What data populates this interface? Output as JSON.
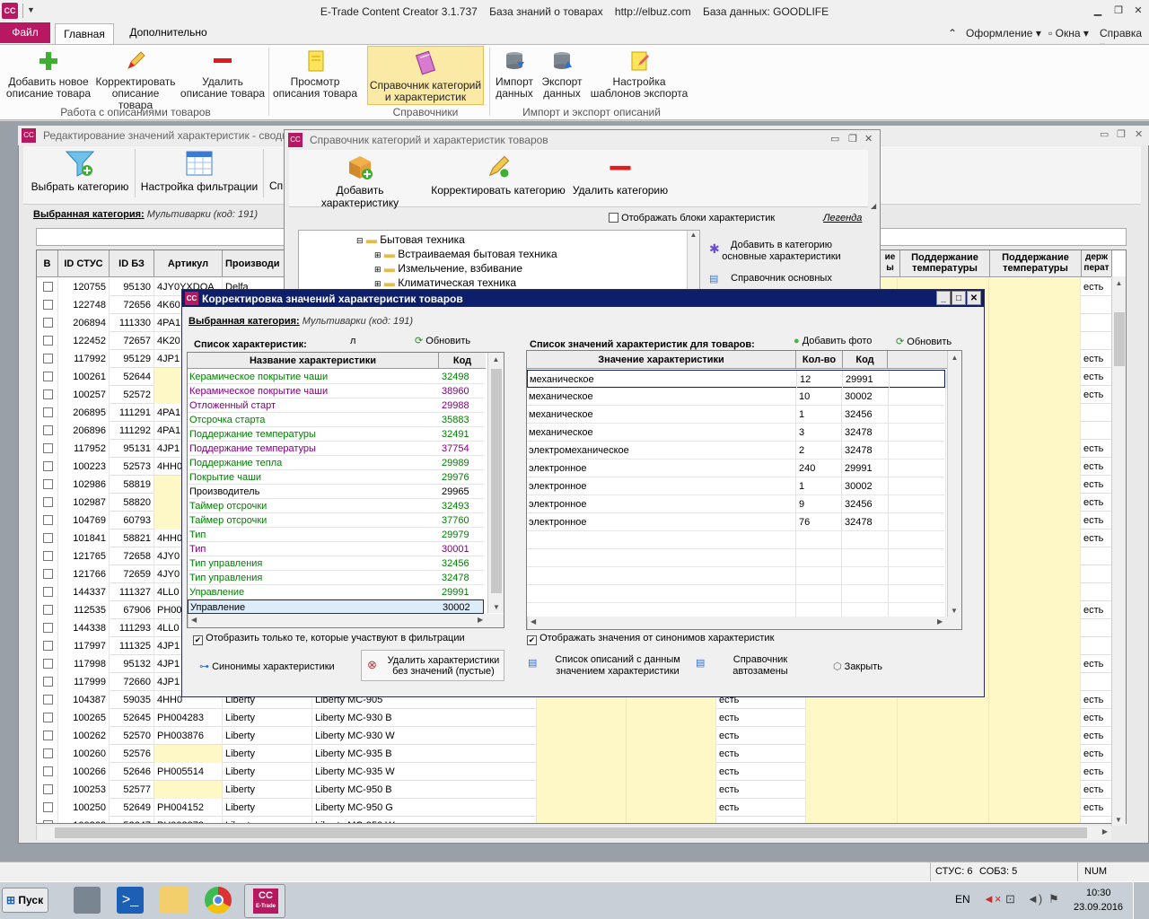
{
  "window": {
    "app": "E-Trade Content Creator 3.1.737",
    "kb": "База знаний о товарах",
    "url": "http://elbuz.com",
    "db": "База данных: GOODLIFE"
  },
  "ribbon_tabs": {
    "file": "Файл",
    "main": "Главная",
    "extra": "Дополнительно"
  },
  "ribbon_right": {
    "design": "Оформление",
    "windows": "Окна",
    "help": "Справка"
  },
  "ribbon": {
    "add_l1": "Добавить новое",
    "add_l2": "описание товара",
    "edit_l1": "Корректировать",
    "edit_l2": "описание товара",
    "del_l1": "Удалить",
    "del_l2": "описание товара",
    "view_l1": "Просмотр",
    "view_l2": "описания товара",
    "cat_l1": "Справочник категорий",
    "cat_l2": "и характеристик",
    "imp_l1": "Импорт",
    "imp_l2": "данных",
    "exp_l1": "Экспорт",
    "exp_l2": "данных",
    "tpl_l1": "Настройка",
    "tpl_l2": "шаблонов экспорта",
    "group1": "Работа с описаниями товаров",
    "group2": "Справочники",
    "group3": "Импорт и экспорт описаний"
  },
  "back_window": {
    "title": "Редактирование значений характеристик - сводн",
    "btn_select": "Выбрать категорию",
    "btn_filter": "Настройка фильтрации",
    "btn_cut": "Сп",
    "category_label": "Выбранная категория:",
    "category_value": "Мультиварки (код: 191)",
    "headers": [
      "В",
      "ID СТУС",
      "ID БЗ",
      "Артикул",
      "Производи"
    ],
    "right_headers": [
      "Поддержание температуры",
      "Поддержание температуры",
      "держ перат"
    ],
    "partial_header": "ие ы",
    "rows": [
      {
        "a": "120755",
        "b": "95130",
        "c": "4JY0YXDQA",
        "d": "Delfa",
        "e": "",
        "f": "",
        "g": "есть"
      },
      {
        "a": "122748",
        "b": "72656",
        "c": "4K60",
        "d": "",
        "e": "",
        "f": "",
        "g": ""
      },
      {
        "a": "206894",
        "b": "111330",
        "c": "4PA1",
        "d": "",
        "e": "",
        "f": "",
        "g": ""
      },
      {
        "a": "122452",
        "b": "72657",
        "c": "4K20",
        "d": "",
        "e": "",
        "f": "",
        "g": ""
      },
      {
        "a": "117992",
        "b": "95129",
        "c": "4JP1",
        "d": "",
        "e": "",
        "f": "",
        "g": "есть"
      },
      {
        "a": "100261",
        "b": "52644",
        "c": "",
        "d": "",
        "e": "",
        "f": "",
        "g": "есть"
      },
      {
        "a": "100257",
        "b": "52572",
        "c": "",
        "d": "",
        "e": "",
        "f": "",
        "g": "есть"
      },
      {
        "a": "206895",
        "b": "111291",
        "c": "4PA1",
        "d": "",
        "e": "",
        "f": "",
        "g": ""
      },
      {
        "a": "206896",
        "b": "111292",
        "c": "4PA1",
        "d": "",
        "e": "",
        "f": "",
        "g": ""
      },
      {
        "a": "117952",
        "b": "95131",
        "c": "4JP1",
        "d": "",
        "e": "",
        "f": "",
        "g": "есть"
      },
      {
        "a": "100223",
        "b": "52573",
        "c": "4HH0",
        "d": "",
        "e": "",
        "f": "",
        "g": "есть"
      },
      {
        "a": "102986",
        "b": "58819",
        "c": "",
        "d": "",
        "e": "",
        "f": "",
        "g": "есть"
      },
      {
        "a": "102987",
        "b": "58820",
        "c": "",
        "d": "",
        "e": "",
        "f": "",
        "g": "есть"
      },
      {
        "a": "104769",
        "b": "60793",
        "c": "",
        "d": "",
        "e": "",
        "f": "",
        "g": "есть"
      },
      {
        "a": "101841",
        "b": "58821",
        "c": "4HH0",
        "d": "",
        "e": "",
        "f": "",
        "g": "есть"
      },
      {
        "a": "121765",
        "b": "72658",
        "c": "4JY0",
        "d": "",
        "e": "",
        "f": "",
        "g": ""
      },
      {
        "a": "121766",
        "b": "72659",
        "c": "4JY0",
        "d": "",
        "e": "",
        "f": "",
        "g": ""
      },
      {
        "a": "144337",
        "b": "111327",
        "c": "4LL0",
        "d": "",
        "e": "",
        "f": "",
        "g": ""
      },
      {
        "a": "112535",
        "b": "67906",
        "c": "PH00",
        "d": "",
        "e": "",
        "f": "",
        "g": "есть"
      },
      {
        "a": "144338",
        "b": "111293",
        "c": "4LL0",
        "d": "",
        "e": "",
        "f": "",
        "g": ""
      },
      {
        "a": "117997",
        "b": "111325",
        "c": "4JP1",
        "d": "",
        "e": "",
        "f": "",
        "g": ""
      },
      {
        "a": "117998",
        "b": "95132",
        "c": "4JP1",
        "d": "",
        "e": "",
        "f": "",
        "g": "есть"
      },
      {
        "a": "117999",
        "b": "72660",
        "c": "4JP1",
        "d": "",
        "e": "",
        "f": "",
        "g": ""
      },
      {
        "a": "104387",
        "b": "59035",
        "c": "4HH0",
        "d": "Liberty",
        "e": "Liberty MC-905",
        "f": "есть",
        "g": "есть"
      },
      {
        "a": "100265",
        "b": "52645",
        "c": "PH004283",
        "d": "Liberty",
        "e": "Liberty MC-930 B",
        "f": "есть",
        "g": "есть"
      },
      {
        "a": "100262",
        "b": "52570",
        "c": "PH003876",
        "d": "Liberty",
        "e": "Liberty MC-930 W",
        "f": "есть",
        "g": "есть"
      },
      {
        "a": "100260",
        "b": "52576",
        "c": "",
        "d": "Liberty",
        "e": "Liberty MC-935 B",
        "f": "есть",
        "g": "есть"
      },
      {
        "a": "100266",
        "b": "52646",
        "c": "PH005514",
        "d": "Liberty",
        "e": "Liberty MC-935 W",
        "f": "есть",
        "g": "есть"
      },
      {
        "a": "100253",
        "b": "52577",
        "c": "",
        "d": "Liberty",
        "e": "Liberty MC-950 B",
        "f": "есть",
        "g": "есть"
      },
      {
        "a": "100250",
        "b": "52649",
        "c": "PH004152",
        "d": "Liberty",
        "e": "Liberty MC-950 G",
        "f": "есть",
        "g": "есть"
      },
      {
        "a": "100263",
        "b": "52647",
        "c": "PH003878",
        "d": "Liberty",
        "e": "Liberty MC-950 W",
        "f": "есть",
        "g": "есть"
      }
    ]
  },
  "catalog_window": {
    "title": "Справочник категорий и характеристик товаров",
    "btn_add": "Добавить характеристику",
    "btn_edit": "Корректировать категорию",
    "btn_del": "Удалить категорию",
    "show_blocks": "Отображать блоки характеристик",
    "legend": "Легенда",
    "tree": [
      "Бытовая техника",
      "Встраиваемая бытовая техника",
      "Измельчение, взбивание",
      "Климатическая техника"
    ],
    "side_btn1_l1": "Добавить в категорию",
    "side_btn1_l2": "основные характеристики",
    "side_btn2": "Справочник основных"
  },
  "dialog": {
    "title": "Корректировка значений характеристик товаров",
    "category_label": "Выбранная категория:",
    "category_value": "Мультиварки (код: 191)",
    "list_title": "Список характеристик:",
    "search_text": "л",
    "refresh": "Обновить",
    "col_name": "Название характеристики",
    "col_code": "Код",
    "items": [
      {
        "name": "Керамическое покрытие чаши",
        "code": "32498",
        "color": "#008000"
      },
      {
        "name": "Керамическое покрытие чаши",
        "code": "38960",
        "color": "#800080"
      },
      {
        "name": "Отложенный старт",
        "code": "29988",
        "color": "#800080"
      },
      {
        "name": "Отсрочка старта",
        "code": "35883",
        "color": "#008000"
      },
      {
        "name": "Поддержание температуры",
        "code": "32491",
        "color": "#008000"
      },
      {
        "name": "Поддержание температуры",
        "code": "37754",
        "color": "#800080"
      },
      {
        "name": "Поддержание тепла",
        "code": "29989",
        "color": "#008000"
      },
      {
        "name": "Покрытие чаши",
        "code": "29976",
        "color": "#008000"
      },
      {
        "name": "Производитель",
        "code": "29965",
        "color": "#000000"
      },
      {
        "name": "Таймер отсрочки",
        "code": "32493",
        "color": "#008000"
      },
      {
        "name": "Таймер отсрочки",
        "code": "37760",
        "color": "#008000"
      },
      {
        "name": "Тип",
        "code": "29979",
        "color": "#008000"
      },
      {
        "name": "Тип",
        "code": "30001",
        "color": "#800080"
      },
      {
        "name": "Тип управления",
        "code": "32456",
        "color": "#008000"
      },
      {
        "name": "Тип управления",
        "code": "32478",
        "color": "#008000"
      },
      {
        "name": "Управление",
        "code": "29991",
        "color": "#008000"
      },
      {
        "name": "Управление",
        "code": "30002",
        "color": "#000000"
      }
    ],
    "values_title": "Список значений характеристик для товаров:",
    "add_photo": "Добавить фото",
    "refresh2": "Обновить",
    "col_value": "Значение характеристики",
    "col_count": "Кол-во",
    "col_code2": "Код",
    "values": [
      {
        "v": "механическое",
        "n": "12",
        "c": "29991"
      },
      {
        "v": "механическое",
        "n": "10",
        "c": "30002"
      },
      {
        "v": "механическое",
        "n": "1",
        "c": "32456"
      },
      {
        "v": "механическое",
        "n": "3",
        "c": "32478"
      },
      {
        "v": "электромеханическое",
        "n": "2",
        "c": "32478"
      },
      {
        "v": "электронное",
        "n": "240",
        "c": "29991"
      },
      {
        "v": "электронное",
        "n": "1",
        "c": "30002"
      },
      {
        "v": "электронное",
        "n": "9",
        "c": "32456"
      },
      {
        "v": "электронное",
        "n": "76",
        "c": "32478"
      }
    ],
    "chk_filter": "Отобразить только те, которые участвуют в фильтрации",
    "chk_syn": "Отображать значения от синонимов характеристик",
    "btn_syn": "Синонимы характеристики",
    "btn_delempty_l1": "Удалить характеристики",
    "btn_delempty_l2": "без значений (пустые)",
    "btn_list_l1": "Список описаний с данным",
    "btn_list_l2": "значением характеристики",
    "btn_repl_l1": "Справочник",
    "btn_repl_l2": "автозамены",
    "btn_close": "Закрыть"
  },
  "status": {
    "stus": "СТУС: 6",
    "sobz": "СОБЗ: 5",
    "num": "NUM"
  },
  "taskbar": {
    "start": "Пуск",
    "lang": "EN",
    "time": "10:30",
    "date": "23.09.2016",
    "app_badge": "E-Trade"
  }
}
